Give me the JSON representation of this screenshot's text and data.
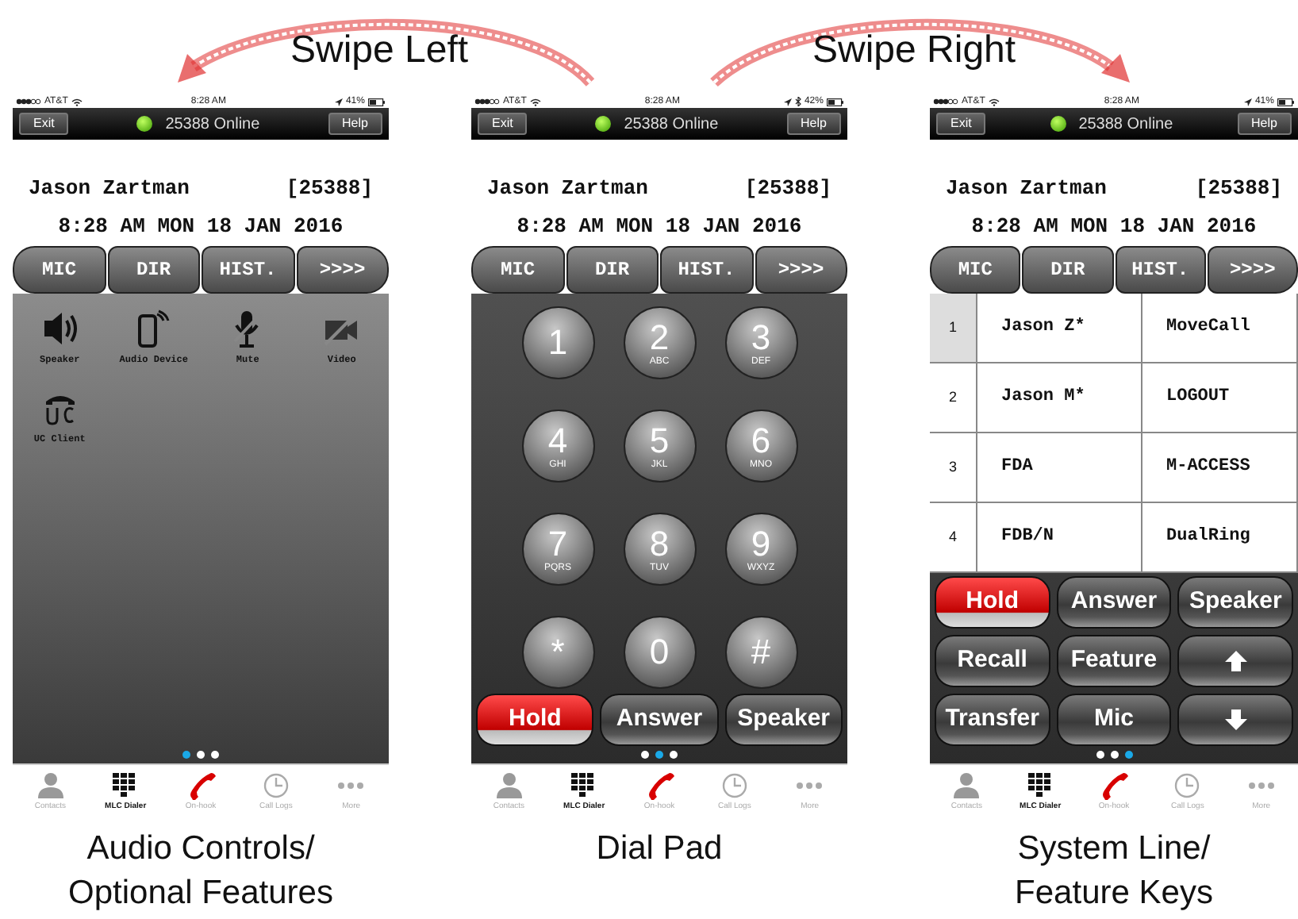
{
  "annotations": [
    {
      "label": "Swipe Left"
    },
    {
      "label": "Swipe Right"
    }
  ],
  "phones": [
    {
      "status": {
        "carrier": "AT&T",
        "time": "8:28 AM",
        "battery": "41%",
        "bluetooth": false
      },
      "header": {
        "exit": "Exit",
        "online": "25388 Online",
        "help": "Help"
      },
      "user": "Jason Zartman",
      "extension": "[25388]",
      "datetime": "8:28 AM MON 18 JAN 2016",
      "tabs": [
        "MIC",
        "DIR",
        "HIST.",
        ">>>>"
      ],
      "kind": "features",
      "features": [
        {
          "label": "Speaker"
        },
        {
          "label": "Audio Device"
        },
        {
          "label": "Mute"
        },
        {
          "label": "Video"
        },
        {
          "label": "UC Client"
        }
      ],
      "pager": [
        {
          "selected": true
        },
        {
          "selected": false
        },
        {
          "selected": false
        }
      ],
      "tabbar": [
        {
          "label": "Contacts",
          "selected": false
        },
        {
          "label": "MLC Dialer",
          "selected": true
        },
        {
          "label": "On-hook",
          "selected": false
        },
        {
          "label": "Call Logs",
          "selected": false
        },
        {
          "label": "More",
          "selected": false
        }
      ],
      "caption": [
        "Audio Controls/",
        "Optional Features"
      ]
    },
    {
      "status": {
        "carrier": "AT&T",
        "time": "8:28 AM",
        "battery": "42%",
        "bluetooth": true
      },
      "header": {
        "exit": "Exit",
        "online": "25388 Online",
        "help": "Help"
      },
      "user": "Jason Zartman",
      "extension": "[25388]",
      "datetime": "8:28 AM MON 18 JAN 2016",
      "tabs": [
        "MIC",
        "DIR",
        "HIST.",
        ">>>>"
      ],
      "kind": "dialpad",
      "keys": [
        {
          "digit": "1"
        },
        {
          "digit": "2",
          "letters": "ABC"
        },
        {
          "digit": "3",
          "letters": "DEF"
        },
        {
          "digit": "4",
          "letters": "GHI"
        },
        {
          "digit": "5",
          "letters": "JKL"
        },
        {
          "digit": "6",
          "letters": "MNO"
        },
        {
          "digit": "7",
          "letters": "PQRS"
        },
        {
          "digit": "8",
          "letters": "TUV"
        },
        {
          "digit": "9",
          "letters": "WXYZ"
        },
        {
          "digit": "*"
        },
        {
          "digit": "0"
        },
        {
          "digit": "#"
        }
      ],
      "buttons": [
        {
          "label": "Hold",
          "highlighted": true
        },
        {
          "label": "Answer",
          "highlighted": false
        },
        {
          "label": "Speaker",
          "highlighted": false
        }
      ],
      "pager": [
        {
          "selected": false
        },
        {
          "selected": true
        },
        {
          "selected": false
        }
      ],
      "tabbar": [
        {
          "label": "Contacts",
          "selected": false
        },
        {
          "label": "MLC Dialer",
          "selected": true
        },
        {
          "label": "On-hook",
          "selected": false
        },
        {
          "label": "Call Logs",
          "selected": false
        },
        {
          "label": "More",
          "selected": false
        }
      ],
      "caption": [
        "Dial Pad"
      ]
    },
    {
      "status": {
        "carrier": "AT&T",
        "time": "8:28 AM",
        "battery": "41%",
        "bluetooth": false
      },
      "header": {
        "exit": "Exit",
        "online": "25388 Online",
        "help": "Help"
      },
      "user": "Jason Zartman",
      "extension": "[25388]",
      "datetime": "8:28 AM MON 18 JAN 2016",
      "tabs": [
        "MIC",
        "DIR",
        "HIST.",
        ">>>>"
      ],
      "kind": "lines",
      "rows": [
        {
          "number": "1",
          "line": "Jason Z*",
          "feature": "MoveCall",
          "selected": true
        },
        {
          "number": "2",
          "line": "Jason M*",
          "feature": "LOGOUT",
          "selected": false
        },
        {
          "number": "3",
          "line": "FDA",
          "feature": "M-ACCESS",
          "selected": false
        },
        {
          "number": "4",
          "line": "FDB/N",
          "feature": "DualRing",
          "selected": false
        }
      ],
      "buttons": [
        {
          "label": "Hold",
          "highlighted": true
        },
        {
          "label": "Answer",
          "highlighted": false
        },
        {
          "label": "Speaker",
          "highlighted": false
        },
        {
          "label": "Recall",
          "highlighted": false
        },
        {
          "label": "Feature",
          "highlighted": false
        },
        {
          "kind": "up",
          "highlighted": false
        },
        {
          "label": "Transfer",
          "highlighted": false
        },
        {
          "label": "Mic",
          "highlighted": false
        },
        {
          "kind": "down",
          "highlighted": false
        }
      ],
      "pager": [
        {
          "selected": false
        },
        {
          "selected": false
        },
        {
          "selected": true
        }
      ],
      "tabbar": [
        {
          "label": "Contacts",
          "selected": false
        },
        {
          "label": "MLC Dialer",
          "selected": true
        },
        {
          "label": "On-hook",
          "selected": false
        },
        {
          "label": "Call Logs",
          "selected": false
        },
        {
          "label": "More",
          "selected": false
        }
      ],
      "caption": [
        "System Line/",
        "Feature Keys"
      ]
    }
  ]
}
